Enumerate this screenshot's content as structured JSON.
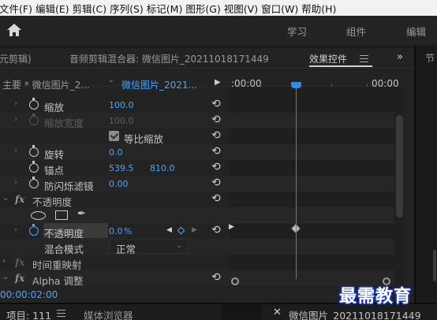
{
  "menu": [
    "文件(F)",
    "编辑(E)",
    "剪辑(C)",
    "序列(S)",
    "标记(M)",
    "图形(G)",
    "视图(V)",
    "窗口(W)",
    "帮助(H)"
  ],
  "workspaces": [
    "学习",
    "组件",
    "编辑"
  ],
  "panel_tabs": {
    "source_clip": "元剪辑)",
    "audio_mixer": "音频剪辑混合器: 微信图片_20211018171449",
    "effect_controls": "效果控件",
    "overflow": "»",
    "right_panel_title": "节"
  },
  "clip_header": {
    "master": "主要 * 微信图片_2...",
    "dropdown_arrow": "⌄",
    "clip": "微信图片_2021...",
    "play": "▶"
  },
  "properties": {
    "scale": {
      "label": "缩放",
      "value": "100.0"
    },
    "scale_width": {
      "label": "缩放宽度",
      "value": "100.0"
    },
    "uniform_scale": {
      "label": "等比缩放"
    },
    "rotation": {
      "label": "旋转",
      "value": "0.0"
    },
    "anchor": {
      "label": "锚点",
      "x": "539.5",
      "y": "810.0"
    },
    "anti_flicker": {
      "label": "防闪烁滤镜",
      "value": "0.00"
    },
    "opacity_section": {
      "fx": "fx",
      "label": "不透明度"
    },
    "opacity": {
      "label": "不透明度",
      "value": "0.0",
      "unit": "%"
    },
    "blend_mode": {
      "label": "混合模式",
      "value": "正常"
    },
    "time_remap": {
      "fx": "fx",
      "label": "时间重映射"
    },
    "alpha_adjust": {
      "fx": "fx",
      "label": "Alpha 调整"
    }
  },
  "timeline": {
    "start": ":00:00",
    "end": "00:00",
    "current_time": "00:00:02:00"
  },
  "bottom_tabs": {
    "project": "项目: 111",
    "media_browser": "媒体浏览器",
    "sequence": "微信图片_20211018171449"
  },
  "watermark": "最需教育",
  "colors": {
    "accent": "#4da3ff",
    "playhead": "#2d8ceb",
    "background": "#232323"
  },
  "icons": {
    "home": "home-icon",
    "reset": "reset-icon",
    "stopwatch": "stopwatch-icon",
    "keyframe": "keyframe-diamond-icon"
  }
}
